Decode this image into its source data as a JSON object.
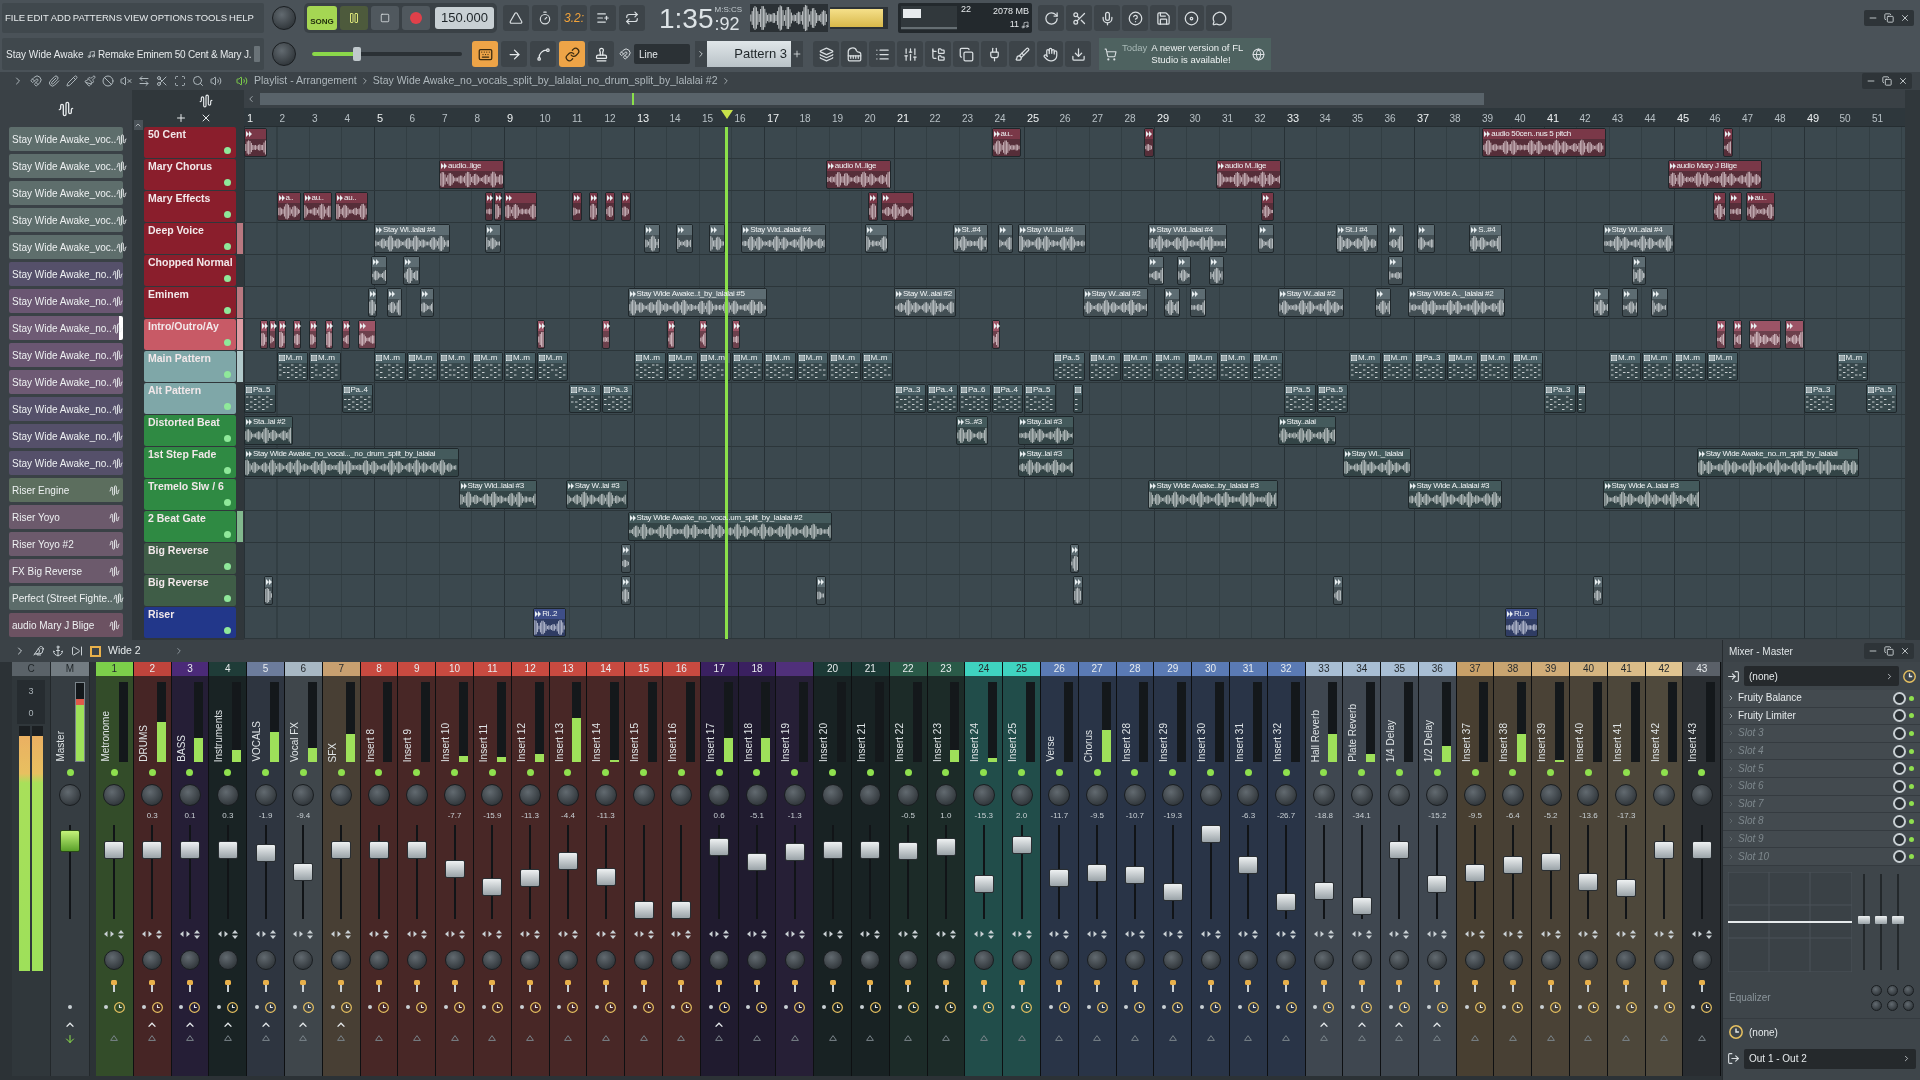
{
  "menu": [
    "FILE",
    "EDIT",
    "ADD",
    "PATTERNS",
    "VIEW",
    "OPTIONS",
    "TOOLS",
    "HELP"
  ],
  "song": {
    "title": "Stay Wide Awake",
    "subtitle": "Remake Eminem 50 Cent & Mary J."
  },
  "transport": {
    "mode": "SONG",
    "song_mode": true,
    "playing": true,
    "recording": false,
    "tempo": "150.000",
    "time": "1:35",
    "centiseconds": ":92",
    "time_format": "M:S:CS"
  },
  "toolbar": {
    "record_tools": [
      {
        "on": false
      },
      {
        "on": false
      },
      {
        "on": true,
        "label": "3.2:"
      },
      {
        "on": false
      },
      {
        "on": false
      }
    ],
    "edit_tools": [
      {
        "on": true
      },
      {
        "on": false
      },
      {
        "on": false
      },
      {
        "on": true
      },
      {
        "on": false
      }
    ],
    "snap": "Line",
    "pattern": "Pattern 3",
    "master_volume": {
      "level": 0.3
    },
    "output_meter": {
      "level": 0.92
    }
  },
  "monitor": {
    "cpu": "22",
    "memory": "2078 MB",
    "polyphony": "11"
  },
  "news": {
    "date": "Today",
    "message": "A newer version of FL Studio is available!"
  },
  "playlist": {
    "title": "Playlist - Arrangement",
    "clip_source": "Stay Wide Awake_no_vocals_split_by_lalalai_no_drum_split_by_lalalai #2",
    "bars": [
      "1",
      "2",
      "3",
      "4",
      "5",
      "6",
      "7",
      "8",
      "9",
      "10",
      "11",
      "12",
      "13",
      "14",
      "15",
      "16",
      "17",
      "18",
      "19",
      "20",
      "21",
      "22",
      "23",
      "24",
      "25",
      "26",
      "27",
      "28",
      "29",
      "30",
      "31",
      "32",
      "33",
      "34",
      "35",
      "36",
      "37",
      "38",
      "39",
      "40",
      "41",
      "42",
      "43",
      "44",
      "45",
      "46",
      "47",
      "48",
      "49",
      "50",
      "51"
    ],
    "channels": [
      {
        "name": "Stay Wide Awake_voc..",
        "color": "#5e6e6c",
        "selected": false
      },
      {
        "name": "Stay Wide Awake_voc..",
        "color": "#5e6e6c",
        "selected": false
      },
      {
        "name": "Stay Wide Awake_voc..",
        "color": "#5e6e6c",
        "selected": false
      },
      {
        "name": "Stay Wide Awake_voc..",
        "color": "#5e6e6c",
        "selected": false
      },
      {
        "name": "Stay Wide Awake_voc..",
        "color": "#5e6e6c",
        "selected": false
      },
      {
        "name": "Stay Wide Awake_no..",
        "color": "#55506a",
        "selected": false
      },
      {
        "name": "Stay Wide Awake_no..",
        "color": "#6a5672",
        "selected": false
      },
      {
        "name": "Stay Wide Awake_no..",
        "color": "#6e5a74",
        "selected": true
      },
      {
        "name": "Stay Wide Awake_no..",
        "color": "#6a5672",
        "selected": false
      },
      {
        "name": "Stay Wide Awake_no..",
        "color": "#6e5a74",
        "selected": false
      },
      {
        "name": "Stay Wide Awake_no..",
        "color": "#55506a",
        "selected": false
      },
      {
        "name": "Stay Wide Awake_no..",
        "color": "#55506a",
        "selected": false
      },
      {
        "name": "Stay Wide Awake_no..",
        "color": "#55506a",
        "selected": false
      },
      {
        "name": "Riser Engine",
        "color": "#5c6e5e",
        "selected": false
      },
      {
        "name": "Riser Yoyo",
        "color": "#6c5a6c",
        "selected": false
      },
      {
        "name": "Riser Yoyo #2",
        "color": "#6c5a6c",
        "selected": false
      },
      {
        "name": "FX Big Reverse",
        "color": "#6c5a6c",
        "selected": false
      },
      {
        "name": "Perfect (Street Fighte..",
        "color": "#5c6c6a",
        "selected": false
      },
      {
        "name": "audio Mary J Blige",
        "color": "#6c5262",
        "selected": false
      }
    ],
    "tracks": [
      {
        "name": "50 Cent",
        "color": "#8a1e2c",
        "active": false,
        "muted": false,
        "clips": [
          {
            "kind": "audio",
            "color": "#7a3848"
          },
          {
            "kind": "audio",
            "color": "#7a3848",
            "label": "au.."
          },
          {
            "kind": "audio",
            "color": "#7a3848"
          },
          {
            "kind": "audio",
            "color": "#7a3848",
            "label": "audio 50cen..nus 5 pitch"
          },
          {
            "kind": "audio",
            "color": "#7a3848"
          }
        ]
      },
      {
        "name": "Mary Chorus",
        "color": "#8a1e2c",
        "active": false,
        "muted": false,
        "clips": [
          {
            "kind": "audio",
            "color": "#7a3848",
            "label": "audio..lige"
          },
          {
            "kind": "audio",
            "color": "#7a3848",
            "label": "audio M..lige"
          },
          {
            "kind": "audio",
            "color": "#7a3848",
            "label": "audio M..lige"
          },
          {
            "kind": "audio",
            "color": "#7a3848",
            "label": "audio Mary J Blige"
          }
        ]
      },
      {
        "name": "Mary Effects",
        "color": "#8a1e2c",
        "active": false,
        "muted": false,
        "clips": [
          {
            "kind": "audio",
            "color": "#7a3848",
            "label": "a.."
          },
          {
            "kind": "audio",
            "color": "#7a3848",
            "label": "au.."
          },
          {
            "kind": "audio",
            "color": "#7a3848",
            "label": "au.."
          },
          {
            "kind": "audio",
            "color": "#7a3848"
          },
          {
            "kind": "audio",
            "color": "#7a3848"
          },
          {
            "kind": "audio",
            "color": "#7a3848"
          },
          {
            "kind": "audio",
            "color": "#7a3848"
          },
          {
            "kind": "audio",
            "color": "#7a3848"
          },
          {
            "kind": "audio",
            "color": "#7a3848"
          },
          {
            "kind": "audio",
            "color": "#7a3848"
          },
          {
            "kind": "audio",
            "color": "#7a3848"
          },
          {
            "kind": "audio",
            "color": "#7a3848"
          },
          {
            "kind": "audio",
            "color": "#7a3848"
          },
          {
            "kind": "audio",
            "color": "#7a3848"
          },
          {
            "kind": "audio",
            "color": "#7a3848"
          },
          {
            "kind": "audio",
            "color": "#7a3848",
            "label": "au.."
          }
        ]
      },
      {
        "name": "Deep Voice",
        "color": "#8a1e2c",
        "active": true,
        "muted": false,
        "clips": [
          {
            "kind": "audio",
            "color": "#5d6c72",
            "label": "Stay Wi..lalai #4"
          },
          {
            "kind": "audio",
            "color": "#5d6c72"
          },
          {
            "kind": "audio",
            "color": "#5d6c72"
          },
          {
            "kind": "audio",
            "color": "#5d6c72"
          },
          {
            "kind": "audio",
            "color": "#5d6c72"
          },
          {
            "kind": "audio",
            "color": "#5d6c72",
            "label": "Stay Wid..alalai #4"
          },
          {
            "kind": "audio",
            "color": "#5d6c72"
          },
          {
            "kind": "audio",
            "color": "#5d6c72",
            "label": "St..#4"
          },
          {
            "kind": "audio",
            "color": "#5d6c72"
          },
          {
            "kind": "audio",
            "color": "#5d6c72",
            "label": "Stay Wi..lai #4"
          },
          {
            "kind": "audio",
            "color": "#5d6c72",
            "label": "Stay Wid..lalai #4"
          },
          {
            "kind": "audio",
            "color": "#5d6c72"
          },
          {
            "kind": "audio",
            "color": "#5d6c72",
            "label": "St..l #4"
          },
          {
            "kind": "audio",
            "color": "#5d6c72"
          },
          {
            "kind": "audio",
            "color": "#5d6c72"
          },
          {
            "kind": "audio",
            "color": "#5d6c72",
            "label": "S..#4"
          },
          {
            "kind": "audio",
            "color": "#5d6c72",
            "label": "Stay Wi..alai #4"
          }
        ]
      },
      {
        "name": "Chopped Normal",
        "color": "#8a1e2c",
        "active": false,
        "muted": false,
        "clips": [
          {
            "kind": "audio",
            "color": "#5d6c72"
          },
          {
            "kind": "audio",
            "color": "#5d6c72"
          },
          {
            "kind": "audio",
            "color": "#5d6c72"
          },
          {
            "kind": "audio",
            "color": "#5d6c72"
          },
          {
            "kind": "audio",
            "color": "#5d6c72"
          },
          {
            "kind": "audio",
            "color": "#5d6c72"
          },
          {
            "kind": "audio",
            "color": "#5d6c72"
          }
        ]
      },
      {
        "name": "Eminem",
        "color": "#8a1e2c",
        "active": true,
        "muted": false,
        "clips": [
          {
            "kind": "audio",
            "color": "#5d6c72"
          },
          {
            "kind": "audio",
            "color": "#5d6c72"
          },
          {
            "kind": "audio",
            "color": "#5d6c72"
          },
          {
            "kind": "audio",
            "color": "#5d6c72",
            "label": "Stay Wide Awake..t_by_lalalai #5"
          },
          {
            "kind": "audio",
            "color": "#5d6c72",
            "label": "Stay W..alai #2"
          },
          {
            "kind": "audio",
            "color": "#5d6c72",
            "label": "Stay W..alai #2"
          },
          {
            "kind": "audio",
            "color": "#5d6c72"
          },
          {
            "kind": "audio",
            "color": "#5d6c72"
          },
          {
            "kind": "audio",
            "color": "#5d6c72",
            "label": "Stay W..alai #2"
          },
          {
            "kind": "audio",
            "color": "#5d6c72"
          },
          {
            "kind": "audio",
            "color": "#5d6c72",
            "label": "Stay Wide A.._lalalai #2"
          },
          {
            "kind": "audio",
            "color": "#5d6c72"
          },
          {
            "kind": "audio",
            "color": "#5d6c72"
          },
          {
            "kind": "audio",
            "color": "#5d6c72"
          }
        ]
      },
      {
        "name": "Intro/Outro/Ay",
        "color": "#c85a66",
        "active": true,
        "muted": false,
        "clips": [
          {
            "kind": "audio",
            "color": "#9c5466"
          },
          {
            "kind": "audio",
            "color": "#9c5466"
          },
          {
            "kind": "audio",
            "color": "#9c5466"
          },
          {
            "kind": "audio",
            "color": "#9c5466"
          },
          {
            "kind": "audio",
            "color": "#9c5466"
          },
          {
            "kind": "audio",
            "color": "#9c5466"
          },
          {
            "kind": "audio",
            "color": "#9c5466"
          },
          {
            "kind": "audio",
            "color": "#9c5466"
          },
          {
            "kind": "audio",
            "color": "#9c5466"
          },
          {
            "kind": "audio",
            "color": "#9c5466"
          },
          {
            "kind": "audio",
            "color": "#9c5466"
          },
          {
            "kind": "audio",
            "color": "#9c5466"
          },
          {
            "kind": "audio",
            "color": "#9c5466"
          },
          {
            "kind": "audio",
            "color": "#9c5466"
          },
          {
            "kind": "audio",
            "color": "#9c5466"
          },
          {
            "kind": "audio",
            "color": "#9c5466"
          },
          {
            "kind": "audio",
            "color": "#9c5466"
          },
          {
            "kind": "audio",
            "color": "#9c5466"
          }
        ]
      },
      {
        "name": "Main Pattern",
        "color": "#7fa7a8",
        "active": true,
        "muted": false,
        "clips": [
          {
            "kind": "pattern",
            "color": "#4a6066",
            "label": "M..rn"
          },
          {
            "kind": "pattern",
            "color": "#4a6066",
            "label": "M..rn"
          },
          {
            "kind": "pattern",
            "color": "#4a6066",
            "label": "M..rn"
          },
          {
            "kind": "pattern",
            "color": "#4a6066",
            "label": "M..rn"
          },
          {
            "kind": "pattern",
            "color": "#4a6066",
            "label": "M..rn"
          },
          {
            "kind": "pattern",
            "color": "#4a6066",
            "label": "M..rn"
          },
          {
            "kind": "pattern",
            "color": "#4a6066",
            "label": "M..rn"
          },
          {
            "kind": "pattern",
            "color": "#4a6066",
            "label": "M..rn"
          },
          {
            "kind": "pattern",
            "color": "#4a6066",
            "label": "M..rn"
          },
          {
            "kind": "pattern",
            "color": "#4a6066",
            "label": "M..rn"
          },
          {
            "kind": "pattern",
            "color": "#4a6066",
            "label": "M..rn"
          },
          {
            "kind": "pattern",
            "color": "#4a6066",
            "label": "M..rn"
          },
          {
            "kind": "pattern",
            "color": "#4a6066",
            "label": "M..rn"
          },
          {
            "kind": "pattern",
            "color": "#4a6066",
            "label": "M..rn"
          },
          {
            "kind": "pattern",
            "color": "#4a6066",
            "label": "M..rn"
          },
          {
            "kind": "pattern",
            "color": "#4a6066",
            "label": "M..rn"
          },
          {
            "kind": "pattern",
            "color": "#4a6066",
            "label": "Pa..5"
          },
          {
            "kind": "pattern",
            "color": "#4a6066",
            "label": "M..rn"
          },
          {
            "kind": "pattern",
            "color": "#4a6066",
            "label": "M..rn"
          },
          {
            "kind": "pattern",
            "color": "#4a6066",
            "label": "M..rn"
          },
          {
            "kind": "pattern",
            "color": "#4a6066",
            "label": "M..rn"
          },
          {
            "kind": "pattern",
            "color": "#4a6066",
            "label": "M..rn"
          },
          {
            "kind": "pattern",
            "color": "#4a6066",
            "label": "M..rn"
          },
          {
            "kind": "pattern",
            "color": "#4a6066",
            "label": "M..rn"
          },
          {
            "kind": "pattern",
            "color": "#4a6066",
            "label": "M..rn"
          },
          {
            "kind": "pattern",
            "color": "#4a6066",
            "label": "Pa..3"
          },
          {
            "kind": "pattern",
            "color": "#4a6066",
            "label": "M..rn"
          },
          {
            "kind": "pattern",
            "color": "#4a6066",
            "label": "M..rn"
          },
          {
            "kind": "pattern",
            "color": "#4a6066",
            "label": "M..rn"
          },
          {
            "kind": "pattern",
            "color": "#4a6066",
            "label": "M..rn"
          },
          {
            "kind": "pattern",
            "color": "#4a6066",
            "label": "M..rn"
          },
          {
            "kind": "pattern",
            "color": "#4a6066",
            "label": "M..rn"
          },
          {
            "kind": "pattern",
            "color": "#4a6066",
            "label": "M..rn"
          },
          {
            "kind": "pattern",
            "color": "#4a6066",
            "label": "M..rn"
          }
        ]
      },
      {
        "name": "Alt Pattern",
        "color": "#7fa7a8",
        "active": false,
        "muted": false,
        "clips": [
          {
            "kind": "pattern",
            "color": "#4a6066",
            "label": "Pa..5"
          },
          {
            "kind": "pattern",
            "color": "#4a6066",
            "label": "Pa..4"
          },
          {
            "kind": "pattern",
            "color": "#4a6066",
            "label": "Pa..3"
          },
          {
            "kind": "pattern",
            "color": "#4a6066",
            "label": "Pa..3"
          },
          {
            "kind": "pattern",
            "color": "#4a6066",
            "label": "Pa..3"
          },
          {
            "kind": "pattern",
            "color": "#4a6066",
            "label": "Pa..4"
          },
          {
            "kind": "pattern",
            "color": "#4a6066",
            "label": "Pa..6"
          },
          {
            "kind": "pattern",
            "color": "#4a6066",
            "label": "Pa..4"
          },
          {
            "kind": "pattern",
            "color": "#4a6066",
            "label": "Pa..5"
          },
          {
            "kind": "pattern",
            "color": "#4a6066"
          },
          {
            "kind": "pattern",
            "color": "#4a6066",
            "label": "Pa..5"
          },
          {
            "kind": "pattern",
            "color": "#4a6066",
            "label": "Pa..5"
          },
          {
            "kind": "pattern",
            "color": "#4a6066",
            "label": "Pa..3"
          },
          {
            "kind": "pattern",
            "color": "#4a6066"
          },
          {
            "kind": "pattern",
            "color": "#4a6066",
            "label": "Pa..3"
          },
          {
            "kind": "pattern",
            "color": "#4a6066",
            "label": "Pa..5"
          }
        ]
      },
      {
        "name": "Distorted Beat",
        "color": "#2f8a43",
        "active": false,
        "muted": false,
        "clips": [
          {
            "kind": "audio",
            "color": "#445a5c",
            "label": "Sta..lai #2"
          },
          {
            "kind": "audio",
            "color": "#445a5c",
            "label": "S..#3"
          },
          {
            "kind": "audio",
            "color": "#445a5c",
            "label": "Stay..lai #3"
          },
          {
            "kind": "audio",
            "color": "#445a5c",
            "label": "Stay..alai"
          }
        ]
      },
      {
        "name": "1st Step Fade",
        "color": "#2f8a43",
        "active": false,
        "muted": false,
        "clips": [
          {
            "kind": "audio",
            "color": "#445a5c",
            "label": "Stay Wide Awake_no_vocal..._no_drum_split_by_lalalai"
          },
          {
            "kind": "audio",
            "color": "#445a5c",
            "label": "Stay..lai #3"
          },
          {
            "kind": "audio",
            "color": "#445a5c",
            "label": "Stay Wi.._lalalai"
          },
          {
            "kind": "audio",
            "color": "#445a5c",
            "label": "Stay Wide Awake_no..m_split_by_lalalai"
          }
        ]
      },
      {
        "name": "Tremelo Slw / 6",
        "color": "#2f8a43",
        "active": false,
        "muted": false,
        "clips": [
          {
            "kind": "audio",
            "color": "#445a5c",
            "label": "Stay Wid..lalai #3"
          },
          {
            "kind": "audio",
            "color": "#445a5c",
            "label": "Stay W..lai #3"
          },
          {
            "kind": "audio",
            "color": "#445a5c",
            "label": "Stay Wide Awake..by_lalalai #3"
          },
          {
            "kind": "audio",
            "color": "#445a5c",
            "label": "Stay Wide A..lalalai #3"
          },
          {
            "kind": "audio",
            "color": "#445a5c",
            "label": "Stay Wide A..lalai #3"
          }
        ]
      },
      {
        "name": "2 Beat Gate",
        "color": "#2f8a43",
        "active": true,
        "muted": false,
        "clips": [
          {
            "kind": "audio",
            "color": "#445a5c",
            "label": "Stay Wide Awake_no_voca..um_split_by_lalalai #2"
          }
        ]
      },
      {
        "name": "Big Reverse",
        "color": "#3f5d47",
        "active": false,
        "muted": false,
        "clips": [
          {
            "kind": "audio",
            "color": "#5d6c72"
          },
          {
            "kind": "audio",
            "color": "#5d6c72"
          }
        ]
      },
      {
        "name": "Big Reverse",
        "color": "#3f5d47",
        "active": false,
        "muted": false,
        "clips": [
          {
            "kind": "audio",
            "color": "#5d6c72"
          },
          {
            "kind": "audio",
            "color": "#5d6c72"
          },
          {
            "kind": "audio",
            "color": "#5d6c72"
          },
          {
            "kind": "audio",
            "color": "#5d6c72"
          },
          {
            "kind": "audio",
            "color": "#5d6c72"
          },
          {
            "kind": "audio",
            "color": "#5d6c72"
          }
        ]
      },
      {
        "name": "Riser",
        "color": "#22378a",
        "active": false,
        "muted": false,
        "clips": [
          {
            "kind": "audio",
            "color": "#3e4e88",
            "label": "Ri..2"
          },
          {
            "kind": "audio",
            "color": "#3e4e88",
            "label": "Ri..o"
          }
        ]
      }
    ]
  },
  "mixer": {
    "preset": "Wide 2",
    "master": {
      "header": "C",
      "label": "M",
      "name": "Master",
      "scale": [
        "3",
        "0"
      ],
      "big_meters": [
        {
          "level": 0.96
        },
        {
          "level": 0.96
        }
      ],
      "meter": {
        "level": 0.8
      },
      "fader": {
        "level": 0.9
      }
    },
    "strips": [
      {
        "number": "1",
        "name": "Metronome",
        "color": "#7ccf4a",
        "enabled": true,
        "sends_to_selected": false,
        "meter": {
          "level": 0
        },
        "fader": {
          "level": 0.77
        }
      },
      {
        "number": "2",
        "name": "DRUMS",
        "color": "#c0443c",
        "reading": "0.3",
        "enabled": true,
        "sends_to_selected": true,
        "meter": {
          "level": 0.5
        },
        "fader": {
          "level": 0.77
        }
      },
      {
        "number": "3",
        "name": "BASS",
        "color": "#4b2a78",
        "reading": "0.1",
        "enabled": true,
        "sends_to_selected": true,
        "meter": {
          "level": 0.3
        },
        "fader": {
          "level": 0.77
        }
      },
      {
        "number": "4",
        "name": "Instruments",
        "color": "#1f3c38",
        "reading": "0.3",
        "enabled": true,
        "sends_to_selected": true,
        "meter": {
          "level": 0.15
        },
        "fader": {
          "level": 0.77
        }
      },
      {
        "number": "5",
        "name": "VOCALS",
        "color": "#6c7c9c",
        "reading": "-1.9",
        "enabled": true,
        "sends_to_selected": true,
        "meter": {
          "level": 0.38
        },
        "fader": {
          "level": 0.73
        }
      },
      {
        "number": "6",
        "name": "Vocal FX",
        "color": "#a8b8c4",
        "reading": "-9.4",
        "enabled": true,
        "sends_to_selected": true,
        "meter": {
          "level": 0.18
        },
        "fader": {
          "level": 0.5
        }
      },
      {
        "number": "7",
        "name": "SFX",
        "color": "#c8a070",
        "enabled": true,
        "sends_to_selected": true,
        "meter": {
          "level": 0.35
        },
        "fader": {
          "level": 0.77
        }
      },
      {
        "number": "8",
        "name": "Insert 8",
        "color": "#c84a40",
        "enabled": true,
        "sends_to_selected": false,
        "meter": {
          "level": 0
        },
        "fader": {
          "level": 0.77
        }
      },
      {
        "number": "9",
        "name": "Insert 9",
        "color": "#c84a40",
        "enabled": true,
        "sends_to_selected": false,
        "meter": {
          "level": 0
        },
        "fader": {
          "level": 0.77
        }
      },
      {
        "number": "10",
        "name": "Insert 10",
        "color": "#c84a40",
        "reading": "-7.7",
        "enabled": true,
        "sends_to_selected": false,
        "meter": {
          "level": 0.08
        },
        "fader": {
          "level": 0.54
        }
      },
      {
        "number": "11",
        "name": "Insert 11",
        "color": "#c84a40",
        "reading": "-15.9",
        "enabled": true,
        "sends_to_selected": false,
        "meter": {
          "level": 0.06
        },
        "fader": {
          "level": 0.32
        }
      },
      {
        "number": "12",
        "name": "Insert 12",
        "color": "#c84a40",
        "reading": "-11.3",
        "enabled": true,
        "sends_to_selected": false,
        "meter": {
          "level": 0.1
        },
        "fader": {
          "level": 0.43
        }
      },
      {
        "number": "13",
        "name": "Insert 13",
        "color": "#c84a40",
        "reading": "-4.4",
        "enabled": true,
        "sends_to_selected": false,
        "meter": {
          "level": 0.55
        },
        "fader": {
          "level": 0.63
        }
      },
      {
        "number": "14",
        "name": "Insert 14",
        "color": "#c84a40",
        "reading": "-11.3",
        "enabled": true,
        "sends_to_selected": false,
        "meter": {
          "level": 0.03
        },
        "fader": {
          "level": 0.44
        }
      },
      {
        "number": "15",
        "name": "Insert 15",
        "color": "#c84a40",
        "enabled": true,
        "sends_to_selected": false,
        "meter": {
          "level": 0
        },
        "fader": {
          "level": 0.04
        }
      },
      {
        "number": "16",
        "name": "Insert 16",
        "color": "#c84a40",
        "enabled": true,
        "sends_to_selected": false,
        "meter": {
          "level": 0
        },
        "fader": {
          "level": 0.04
        }
      },
      {
        "number": "17",
        "name": "Insert 17",
        "color": "#3a2060",
        "reading": "0.6",
        "enabled": true,
        "sends_to_selected": true,
        "meter": {
          "level": 0.3
        },
        "fader": {
          "level": 0.81
        }
      },
      {
        "number": "18",
        "name": "Insert 18",
        "color": "#3a2060",
        "reading": "-5.1",
        "enabled": true,
        "sends_to_selected": false,
        "meter": {
          "level": 0.3
        },
        "fader": {
          "level": 0.62
        }
      },
      {
        "name": "Insert 19",
        "color": "#50307a",
        "reading": "-1.3",
        "enabled": true,
        "sends_to_selected": false,
        "meter": {
          "level": 0
        },
        "fader": {
          "level": 0.75
        }
      },
      {
        "number": "20",
        "name": "Insert 20",
        "color": "#1c3a36",
        "enabled": true,
        "sends_to_selected": false,
        "meter": {
          "level": 0
        },
        "fader": {
          "level": 0.77
        }
      },
      {
        "number": "21",
        "name": "Insert 21",
        "color": "#1c3a36",
        "enabled": true,
        "sends_to_selected": false,
        "meter": {
          "level": 0
        },
        "fader": {
          "level": 0.77
        }
      },
      {
        "number": "22",
        "name": "Insert 22",
        "color": "#2a5a48",
        "reading": "-0.5",
        "enabled": true,
        "sends_to_selected": false,
        "meter": {
          "level": 0
        },
        "fader": {
          "level": 0.76
        }
      },
      {
        "number": "23",
        "name": "Insert 23",
        "color": "#2a5a48",
        "reading": "1.0",
        "enabled": true,
        "sends_to_selected": false,
        "meter": {
          "level": 0.15
        },
        "fader": {
          "level": 0.81
        }
      },
      {
        "number": "24",
        "name": "Insert 24",
        "color": "#3fd3c0",
        "reading": "-15.3",
        "enabled": true,
        "sends_to_selected": false,
        "meter": {
          "level": 0.05
        },
        "fader": {
          "level": 0.35
        }
      },
      {
        "number": "25",
        "name": "Insert 25",
        "color": "#3fd3c0",
        "reading": "2.0",
        "enabled": true,
        "sends_to_selected": false,
        "meter": {
          "level": 0
        },
        "fader": {
          "level": 0.83
        }
      },
      {
        "number": "26",
        "name": "Verse",
        "color": "#5a7ab4",
        "reading": "-11.7",
        "enabled": true,
        "sends_to_selected": false,
        "meter": {
          "level": 0
        },
        "fader": {
          "level": 0.43
        }
      },
      {
        "number": "27",
        "name": "Chorus",
        "color": "#5a7ab4",
        "reading": "-9.5",
        "enabled": true,
        "sends_to_selected": false,
        "meter": {
          "level": 0.4
        },
        "fader": {
          "level": 0.49
        }
      },
      {
        "number": "28",
        "name": "Insert 28",
        "color": "#5a7ab4",
        "reading": "-10.7",
        "enabled": true,
        "sends_to_selected": false,
        "meter": {
          "level": 0
        },
        "fader": {
          "level": 0.46
        }
      },
      {
        "number": "29",
        "name": "Insert 29",
        "color": "#5a7ab4",
        "reading": "-19.3",
        "enabled": true,
        "sends_to_selected": false,
        "meter": {
          "level": 0
        },
        "fader": {
          "level": 0.26
        }
      },
      {
        "number": "30",
        "name": "Insert 30",
        "color": "#5a7ab4",
        "enabled": true,
        "sends_to_selected": false,
        "meter": {
          "level": 0
        },
        "fader": {
          "level": 0.96
        }
      },
      {
        "number": "31",
        "name": "Insert 31",
        "color": "#5a7ab4",
        "reading": "-6.3",
        "enabled": true,
        "sends_to_selected": false,
        "meter": {
          "level": 0
        },
        "fader": {
          "level": 0.58
        }
      },
      {
        "number": "32",
        "name": "Insert 32",
        "color": "#5a7ab4",
        "reading": "-26.7",
        "enabled": true,
        "sends_to_selected": false,
        "meter": {
          "level": 0
        },
        "fader": {
          "level": 0.14
        }
      },
      {
        "number": "33",
        "name": "Hall Reverb",
        "color": "#a8bed4",
        "reading": "-18.8",
        "enabled": true,
        "sends_to_selected": true,
        "meter": {
          "level": 0.35
        },
        "fader": {
          "level": 0.27
        }
      },
      {
        "number": "34",
        "name": "Plate Reverb",
        "color": "#a8bed4",
        "reading": "-34.1",
        "enabled": true,
        "sends_to_selected": true,
        "meter": {
          "level": 0.1
        },
        "fader": {
          "level": 0.08
        }
      },
      {
        "number": "35",
        "name": "1/4 Delay",
        "color": "#a8bed4",
        "enabled": true,
        "sends_to_selected": true,
        "meter": {
          "level": 0
        },
        "fader": {
          "level": 0.77
        }
      },
      {
        "number": "36",
        "name": "1/2 Delay",
        "color": "#a8bed4",
        "reading": "-15.2",
        "enabled": true,
        "sends_to_selected": true,
        "meter": {
          "level": 0.2
        },
        "fader": {
          "level": 0.35
        }
      },
      {
        "number": "37",
        "name": "Insert 37",
        "color": "#c8a068",
        "reading": "-9.5",
        "enabled": true,
        "sends_to_selected": false,
        "meter": {
          "level": 0
        },
        "fader": {
          "level": 0.49
        }
      },
      {
        "number": "38",
        "name": "Insert 38",
        "color": "#c8a470",
        "reading": "-6.4",
        "enabled": true,
        "sends_to_selected": false,
        "meter": {
          "level": 0.35
        },
        "fader": {
          "level": 0.58
        }
      },
      {
        "number": "39",
        "name": "Insert 39",
        "color": "#d0ac78",
        "reading": "-5.2",
        "enabled": true,
        "sends_to_selected": false,
        "meter": {
          "level": 0.03
        },
        "fader": {
          "level": 0.62
        }
      },
      {
        "number": "40",
        "name": "Insert 40",
        "color": "#d4b480",
        "reading": "-13.6",
        "enabled": true,
        "sends_to_selected": false,
        "meter": {
          "level": 0
        },
        "fader": {
          "level": 0.38
        }
      },
      {
        "number": "41",
        "name": "Insert 41",
        "color": "#dabc88",
        "reading": "-17.3",
        "enabled": true,
        "sends_to_selected": false,
        "meter": {
          "level": 0
        },
        "fader": {
          "level": 0.31
        }
      },
      {
        "number": "42",
        "name": "Insert 42",
        "color": "#e0c490",
        "enabled": true,
        "sends_to_selected": false,
        "meter": {
          "level": 0
        },
        "fader": {
          "level": 0.77
        }
      },
      {
        "number": "43",
        "name": "Insert 43",
        "color": "#5a6068",
        "enabled": true,
        "sends_to_selected": false,
        "meter": {
          "level": 0
        },
        "fader": {
          "level": 0.77
        }
      }
    ],
    "panel": {
      "title": "Mixer - Master",
      "input": "(none)",
      "slots": [
        {
          "name": "Fruity Balance",
          "empty": false
        },
        {
          "name": "Fruity Limiter",
          "empty": false
        },
        {
          "name": "Slot 3",
          "empty": true
        },
        {
          "name": "Slot 4",
          "empty": true
        },
        {
          "name": "Slot 5",
          "empty": true
        },
        {
          "name": "Slot 6",
          "empty": true
        },
        {
          "name": "Slot 7",
          "empty": true
        },
        {
          "name": "Slot 8",
          "empty": true
        },
        {
          "name": "Slot 9",
          "empty": true
        },
        {
          "name": "Slot 10",
          "empty": true
        }
      ],
      "eq_label": "Equalizer",
      "eq_bands": [
        {
          "level": 0.52
        },
        {
          "level": 0.52
        },
        {
          "level": 0.52
        }
      ],
      "send": "(none)",
      "output": "Out 1 - Out 2"
    }
  }
}
